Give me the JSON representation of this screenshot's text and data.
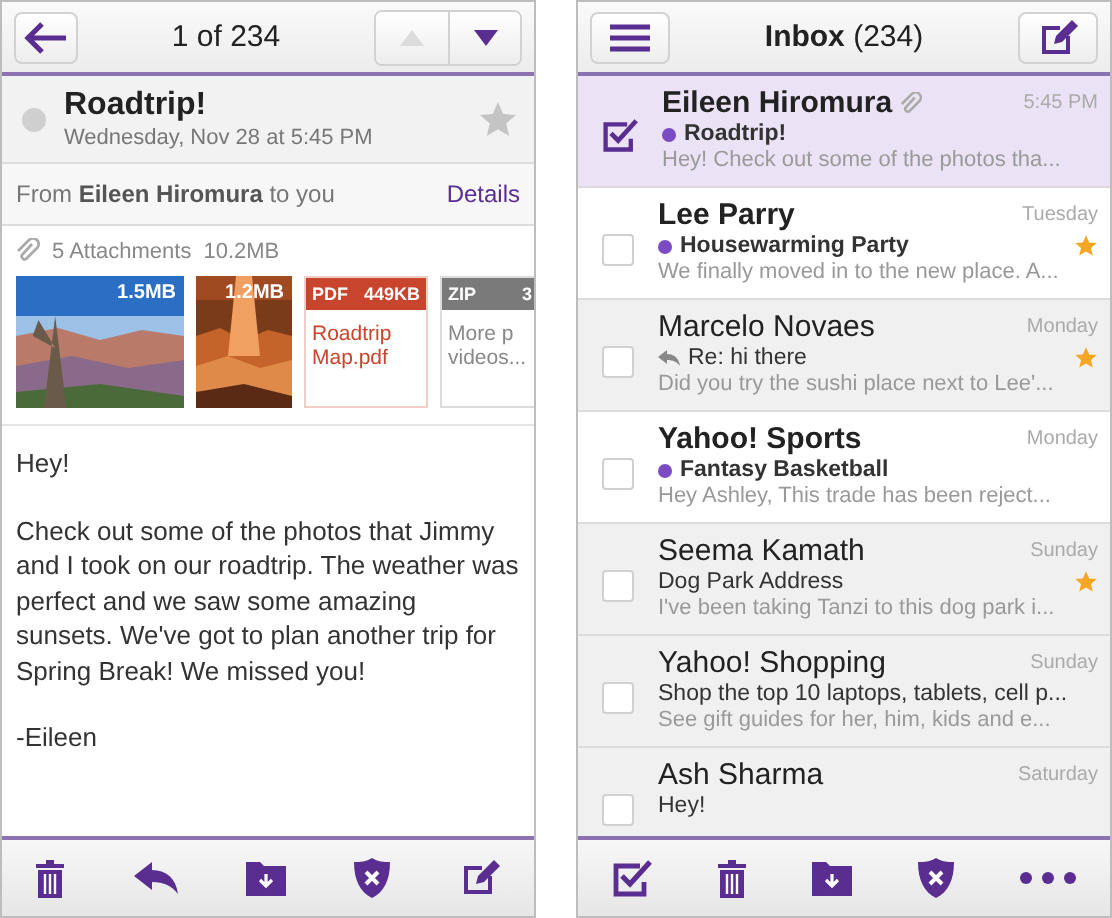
{
  "message_view": {
    "header": {
      "title": "1 of 234",
      "nav": [
        {
          "kind": "up",
          "disabled": true
        },
        {
          "kind": "down",
          "disabled": false
        }
      ]
    },
    "subject": "Roadtrip!",
    "date": "Wednesday, Nov 28 at 5:45 PM",
    "starred": false,
    "from": "From **Eileen Hiromura** to you",
    "details_link": "Details",
    "attachments_summary": "5 Attachments",
    "attachments_size": "10.2MB",
    "attachments": [
      {
        "size": "1.5MB"
      },
      {
        "size": "1.2MB"
      },
      {
        "kind": "file",
        "type": "PDF",
        "size": "449KB",
        "name": "Roadtrip\nMap.pdf",
        "color": "#c8442c"
      },
      {
        "kind": "file",
        "type": "ZIP",
        "size": "3",
        "name": "More p\nvideos...",
        "color": "#7a7a7a"
      }
    ],
    "body": [
      "Hey!",
      "Check out some of the photos that Jimmy and I took on our roadtrip. The weather was perfect and we saw some amazing sunsets. We've got to plan another trip for Spring Break! We missed you!",
      "-Eileen"
    ],
    "toolbar": [
      {
        "kind": "trash"
      },
      {
        "kind": "reply"
      },
      {
        "kind": "move"
      },
      {
        "kind": "spam"
      },
      {
        "kind": "compose"
      }
    ]
  },
  "inbox": {
    "header": {
      "title": "**Inbox** (234)"
    },
    "messages": [
      {
        "sender": "Eileen Hiromura",
        "time": "5:45 PM",
        "subject": "Roadtrip!",
        "preview": "Hey! Check out some of the photos tha...",
        "unread": true,
        "attachment": true,
        "replied": false,
        "starred": false,
        "checked": true,
        "selected": true
      },
      {
        "sender": "Lee Parry",
        "time": "Tuesday",
        "subject": "Housewarming Party",
        "preview": "We finally moved in to the new place. A...",
        "unread": true,
        "attachment": false,
        "replied": false,
        "starred": true,
        "checked": false,
        "selected": false
      },
      {
        "sender": "Marcelo Novaes",
        "time": "Monday",
        "subject": "Re: hi there",
        "preview": "Did you try the sushi place next to Lee'...",
        "unread": false,
        "attachment": false,
        "replied": true,
        "starred": true,
        "checked": false,
        "selected": false
      },
      {
        "sender": "Yahoo! Sports",
        "time": "Monday",
        "subject": "Fantasy Basketball",
        "preview": "Hey Ashley, This trade has been reject...",
        "unread": true,
        "attachment": false,
        "replied": false,
        "starred": false,
        "checked": false,
        "selected": false
      },
      {
        "sender": "Seema Kamath",
        "time": "Sunday",
        "subject": "Dog Park Address",
        "preview": "I've been taking Tanzi to this dog park i...",
        "unread": false,
        "attachment": false,
        "replied": false,
        "starred": true,
        "checked": false,
        "selected": false
      },
      {
        "sender": "Yahoo! Shopping",
        "time": "Sunday",
        "subject": "Shop the top 10 laptops, tablets, cell p...",
        "preview": "See gift guides for her, him, kids and e...",
        "unread": false,
        "attachment": false,
        "replied": false,
        "starred": false,
        "checked": false,
        "selected": false
      },
      {
        "sender": "Ash Sharma",
        "time": "Saturday",
        "subject": "Hey!",
        "unread": false,
        "attachment": false,
        "replied": false,
        "starred": false,
        "checked": false,
        "selected": false
      }
    ],
    "toolbar": [
      {
        "kind": "select"
      },
      {
        "kind": "trash"
      },
      {
        "kind": "move"
      },
      {
        "kind": "spam"
      },
      {
        "kind": "more"
      }
    ]
  }
}
